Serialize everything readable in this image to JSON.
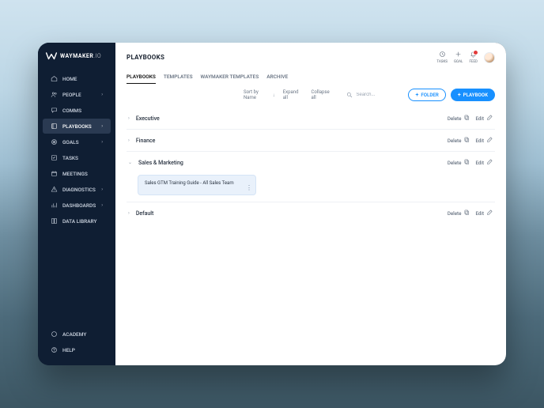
{
  "brand": {
    "name_bold": "WAYMAKER",
    "name_thin": ".IO"
  },
  "sidebar": {
    "items": [
      {
        "id": "home",
        "label": "HOME",
        "icon": "home",
        "expandable": false,
        "active": false
      },
      {
        "id": "people",
        "label": "PEOPLE",
        "icon": "people",
        "expandable": true,
        "active": false
      },
      {
        "id": "comms",
        "label": "COMMS",
        "icon": "comms",
        "expandable": false,
        "active": false
      },
      {
        "id": "playbooks",
        "label": "PLAYBOOKS",
        "icon": "playbooks",
        "expandable": true,
        "active": true
      },
      {
        "id": "goals",
        "label": "GOALS",
        "icon": "goals",
        "expandable": true,
        "active": false
      },
      {
        "id": "tasks",
        "label": "TASKS",
        "icon": "tasks",
        "expandable": false,
        "active": false
      },
      {
        "id": "meetings",
        "label": "MEETINGS",
        "icon": "meetings",
        "expandable": false,
        "active": false
      },
      {
        "id": "diagnostics",
        "label": "DIAGNOSTICS",
        "icon": "diagnostics",
        "expandable": true,
        "active": false
      },
      {
        "id": "dashboards",
        "label": "DASHBOARDS",
        "icon": "dashboards",
        "expandable": true,
        "active": false
      },
      {
        "id": "datalibrary",
        "label": "DATA LIBRARY",
        "icon": "datalibrary",
        "expandable": false,
        "active": false
      }
    ],
    "bottom": [
      {
        "id": "academy",
        "label": "ACADEMY",
        "icon": "academy"
      },
      {
        "id": "help",
        "label": "HELP",
        "icon": "help"
      }
    ]
  },
  "page": {
    "title": "PLAYBOOKS"
  },
  "topbar": {
    "chips": [
      {
        "id": "tasks",
        "label": "TASKS",
        "icon": "clock"
      },
      {
        "id": "goal",
        "label": "GOAL",
        "icon": "plus"
      },
      {
        "id": "feed",
        "label": "FEED",
        "icon": "bell",
        "badge": true
      }
    ]
  },
  "tabs": [
    {
      "id": "playbooks",
      "label": "PLAYBOOKS",
      "active": true
    },
    {
      "id": "templates",
      "label": "TEMPLATES",
      "active": false
    },
    {
      "id": "waymaker_templates",
      "label": "WAYMAKER TEMPLATES",
      "active": false
    },
    {
      "id": "archive",
      "label": "ARCHIVE",
      "active": false
    }
  ],
  "toolbar": {
    "sort_label": "Sort by Name",
    "expand_all": "Expand all",
    "collapse_all": "Collapse all",
    "search_placeholder": "Search...",
    "folder_btn": "FOLDER",
    "playbook_btn": "PLAYBOOK"
  },
  "row_actions": {
    "delete": "Delete",
    "edit": "Edit"
  },
  "categories": [
    {
      "name": "Executive",
      "expanded": false,
      "items": []
    },
    {
      "name": "Finance",
      "expanded": false,
      "items": []
    },
    {
      "name": "Sales & Marketing",
      "expanded": true,
      "items": [
        {
          "title": "Sales GTM Training Guide - All Sales Team"
        }
      ]
    },
    {
      "name": "Default",
      "expanded": false,
      "items": []
    }
  ]
}
